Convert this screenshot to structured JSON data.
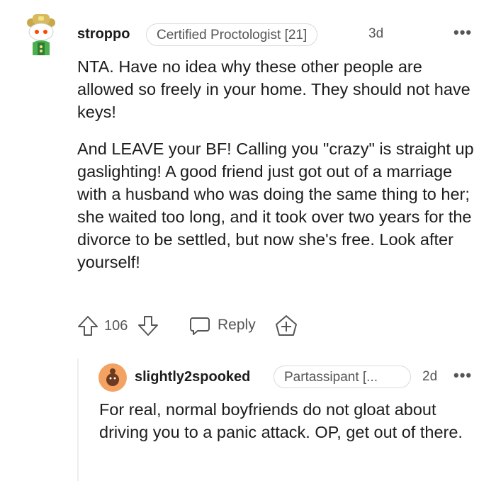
{
  "comment": {
    "username": "stroppo",
    "flair": "Certified Proctologist [21]",
    "age": "3d",
    "more": "•••",
    "paragraphs": [
      "NTA. Have no idea why these other people are allowed so freely in your home. They should not have keys!",
      "And LEAVE your BF! Calling you \"crazy\" is straight up gaslighting! A good friend just got out of a marriage with a husband who was doing the same thing to her; she waited too long, and it took over two years for the divorce to be settled, but now she's free. Look after yourself!"
    ],
    "votes": "106",
    "reply_label": "Reply",
    "icons": {
      "upvote": "arrow-up-outline",
      "downvote": "arrow-down-outline",
      "reply": "speech-bubble",
      "award": "plus-in-shield"
    }
  },
  "reply": {
    "username": "slightly2spooked",
    "flair": "Partassipant [...",
    "age": "2d",
    "more": "•••",
    "text": "For real, normal boyfriends do not gloat about driving you to a panic attack. OP, get out of there."
  },
  "colors": {
    "text": "#1c1c1c",
    "muted": "#555555",
    "border": "#d7dadc",
    "avatar_orange": "#f4a261"
  }
}
